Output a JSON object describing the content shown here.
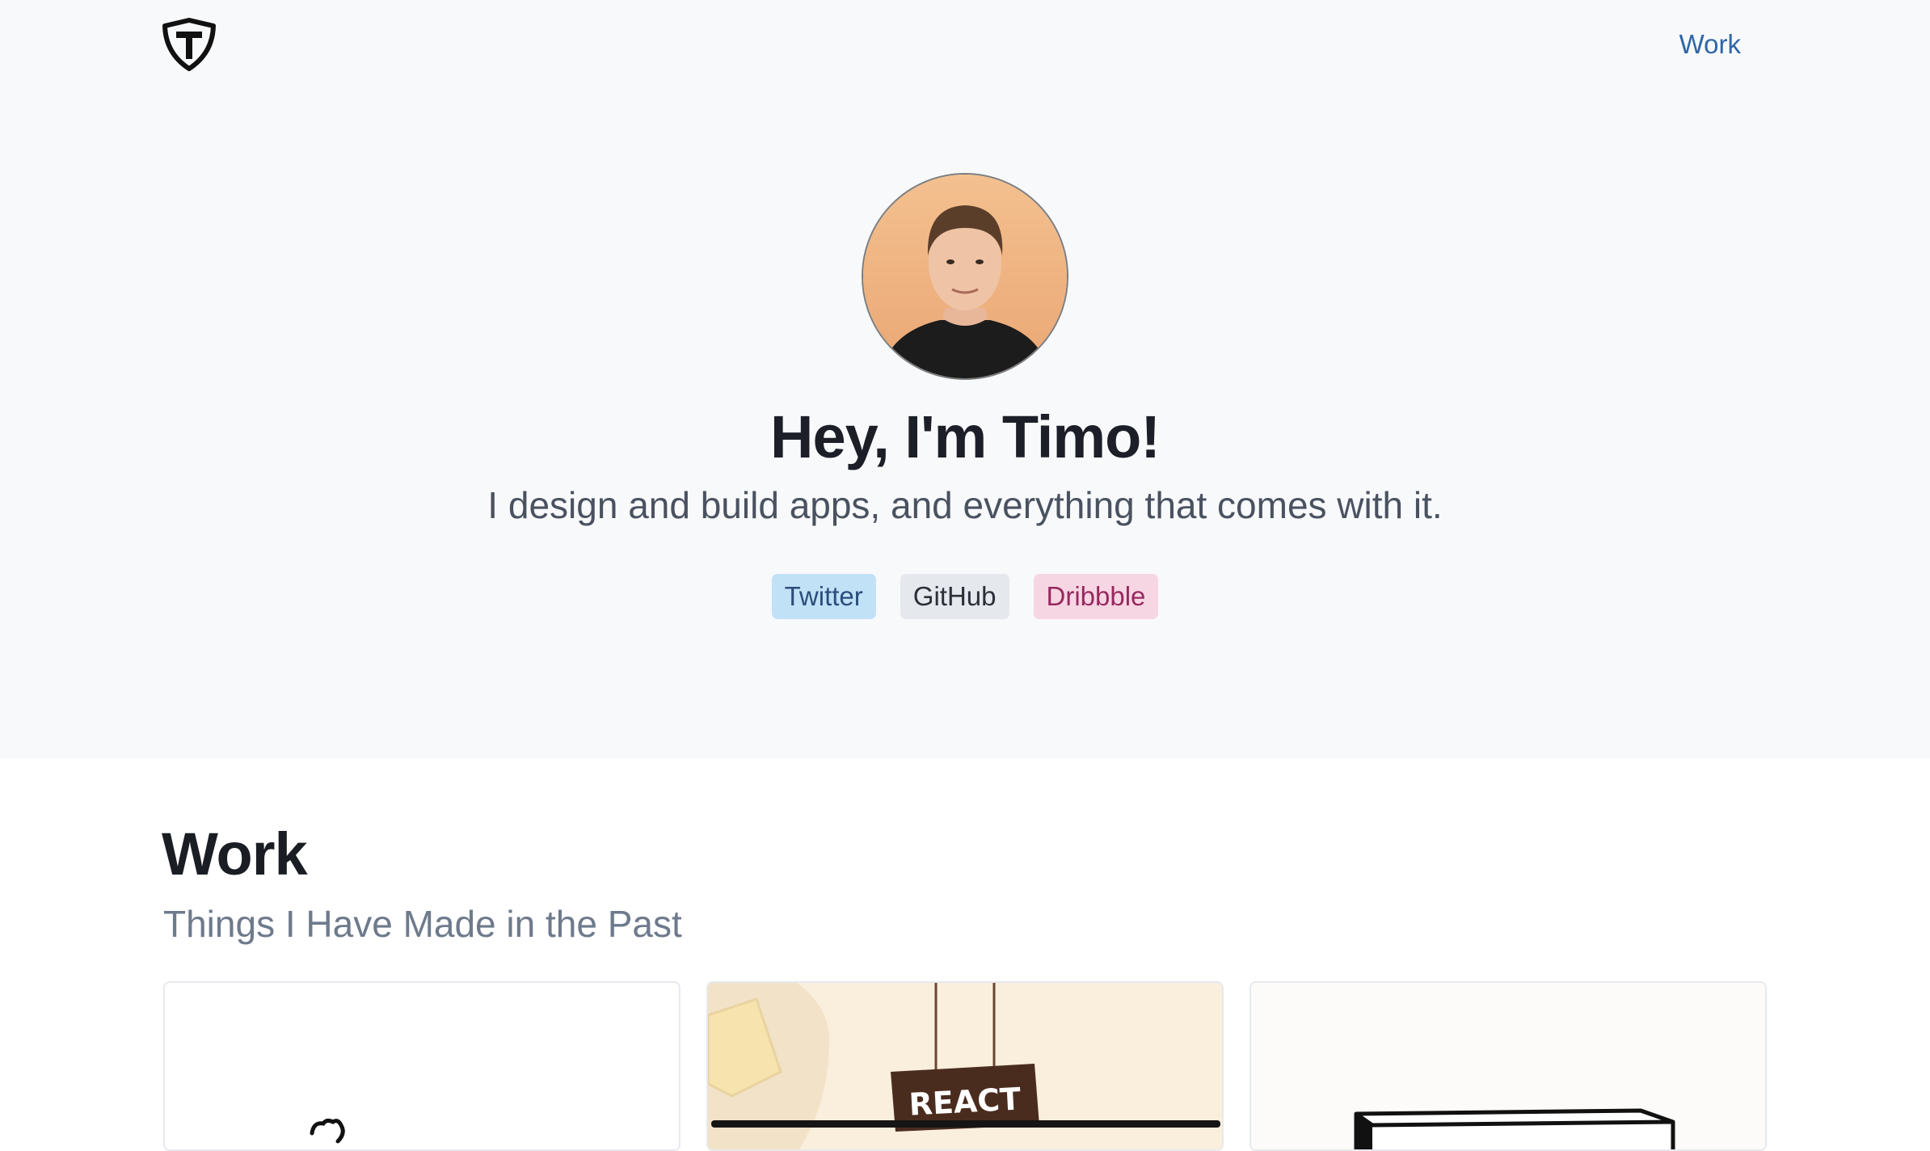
{
  "nav": {
    "logo_icon": "shield-t-logo-icon",
    "work_link": "Work"
  },
  "hero": {
    "avatar_alt": "Timo portrait",
    "title": "Hey, I'm Timo!",
    "subtitle": "I design and build apps, and everything that comes with it.",
    "links": [
      {
        "label": "Twitter",
        "color": "#c1e1f7"
      },
      {
        "label": "GitHub",
        "color": "#e5e8ed"
      },
      {
        "label": "Dribbble",
        "color": "#f7d6e4"
      }
    ]
  },
  "work": {
    "title": "Work",
    "subtitle": "Things I Have Made in the Past",
    "cards": [
      {
        "image": "doodle-illustration"
      },
      {
        "image": "react-sign-illustration",
        "sign_text": "REACT"
      },
      {
        "image": "box-illustration"
      }
    ]
  }
}
